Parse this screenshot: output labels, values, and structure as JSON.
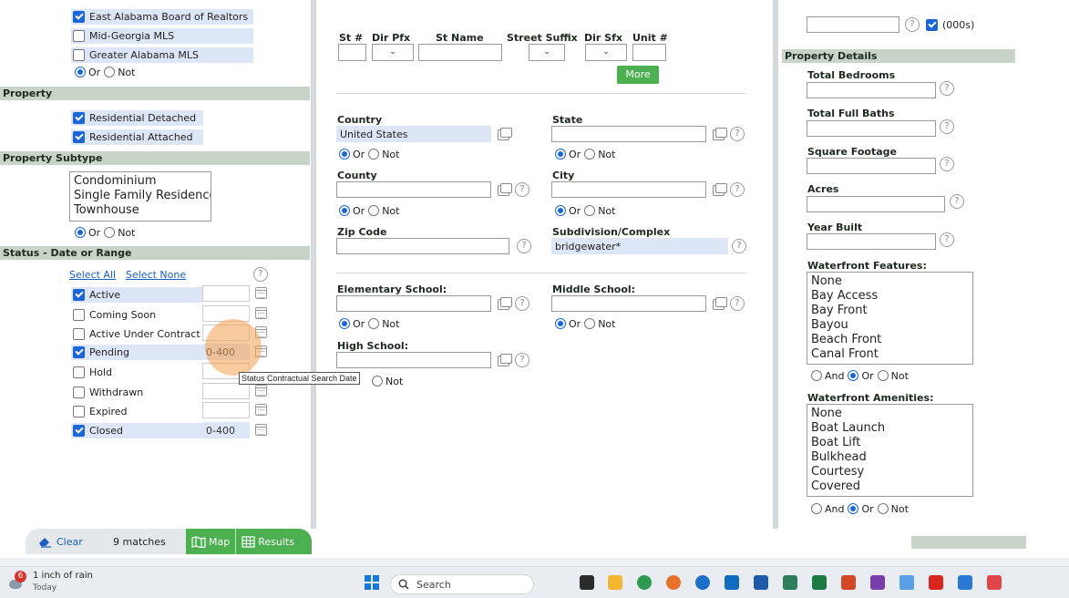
{
  "mls": {
    "options": [
      {
        "label": "East Alabama Board of Realtors",
        "checked": true
      },
      {
        "label": "Mid-Georgia MLS",
        "checked": false
      },
      {
        "label": "Greater Alabama MLS",
        "checked": false
      }
    ],
    "or_label": "Or",
    "not_label": "Not"
  },
  "property": {
    "header": "Property",
    "options": [
      {
        "label": "Residential Detached",
        "checked": true
      },
      {
        "label": "Residential Attached",
        "checked": true
      }
    ]
  },
  "subtype": {
    "header": "Property Subtype",
    "items": [
      "Condominium",
      "Single Family Residence",
      "Townhouse"
    ],
    "or_label": "Or",
    "not_label": "Not"
  },
  "status": {
    "header": "Status - Date or Range",
    "select_all": "Select All",
    "select_none": "Select None",
    "rows": [
      {
        "label": "Active",
        "checked": true,
        "date": ""
      },
      {
        "label": "Coming Soon",
        "checked": false,
        "date": ""
      },
      {
        "label": "Active Under Contract",
        "checked": false,
        "date": ""
      },
      {
        "label": "Pending",
        "checked": true,
        "date": "0-400"
      },
      {
        "label": "Hold",
        "checked": false,
        "date": ""
      },
      {
        "label": "Withdrawn",
        "checked": false,
        "date": ""
      },
      {
        "label": "Expired",
        "checked": false,
        "date": ""
      },
      {
        "label": "Closed",
        "checked": true,
        "date": "0-400"
      }
    ],
    "tooltip": "Status Contractual Search Date"
  },
  "address": {
    "st_num": "St #",
    "dir_pfx": "Dir Pfx",
    "st_name": "St Name",
    "street_suffix": "Street Suffix",
    "dir_sfx": "Dir Sfx",
    "unit": "Unit #",
    "more": "More"
  },
  "location": {
    "country_label": "Country",
    "country_value": "United States",
    "state_label": "State",
    "county_label": "County",
    "city_label": "City",
    "zip_label": "Zip Code",
    "subdivision_label": "Subdivision/Complex",
    "subdivision_value": "bridgewater*",
    "or_label": "Or",
    "not_label": "Not"
  },
  "schools": {
    "elementary": "Elementary School:",
    "middle": "Middle School:",
    "high": "High School:"
  },
  "right": {
    "top_checkbox": "(000s)",
    "header": "Property Details",
    "fields": [
      "Total Bedrooms",
      "Total Full Baths",
      "Square Footage",
      "Acres",
      "Year Built"
    ],
    "waterfront_features": {
      "label": "Waterfront Features:",
      "items": [
        "None",
        "Bay Access",
        "Bay Front",
        "Bayou",
        "Beach Front",
        "Canal Front"
      ]
    },
    "waterfront_amenities": {
      "label": "Waterfront Amenities:",
      "items": [
        "None",
        "Boat Launch",
        "Boat Lift",
        "Bulkhead",
        "Courtesy",
        "Covered"
      ]
    },
    "and_label": "And",
    "or_label": "Or",
    "not_label": "Not"
  },
  "bottombar": {
    "clear": "Clear",
    "matches": "9 matches",
    "map": "Map",
    "results": "Results"
  },
  "taskbar": {
    "weather_badge": "6",
    "weather_title": "1 inch of rain",
    "weather_sub": "Today",
    "search": "Search"
  }
}
